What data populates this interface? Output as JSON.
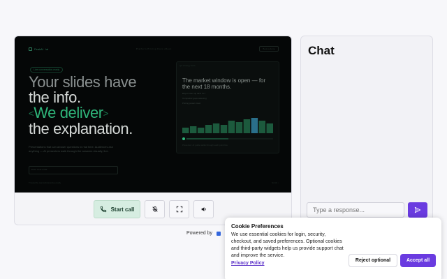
{
  "stage": {
    "brand": "PeakAI",
    "brand_suffix": "/ai",
    "nav": "Platform   Pricing   Docs   About",
    "top_button": "Book a demo",
    "tag": "Live conversation-ready",
    "headline_line1": "Your slides have",
    "headline_line2": "the info.",
    "headline_bracket_open": "<",
    "headline_green": "We deliver",
    "headline_bracket_close": ">",
    "headline_line4": "the explanation.",
    "sub_copy": "Presentations that can answer questions in real time. Audiences ask anything — AI presenters walk through the answers visually, live.",
    "email_label": "Enter work email",
    "footer_left": "Trusted by teams   Enterprise-ready",
    "footer_right": "Scroll ↓",
    "inner_top": "Q3 strategy deck",
    "inner_title": "The market window is open — for the next 18 months.",
    "inner_bullets": [
      "Buyer intent up 32% YoY",
      "Competitor gaps widening",
      "Pricing power intact"
    ],
    "inner_foot": "Presenter: AI guide walks through each point live"
  },
  "controls": {
    "start_call": "Start call"
  },
  "powered_by": "Powered by",
  "chat": {
    "title": "Chat",
    "placeholder": "Type a response..."
  },
  "cookie": {
    "title": "Cookie Preferences",
    "text": "We use essential cookies for login, security, checkout, and saved preferences. Optional cookies and third-party widgets help us provide support chat and improve the service.",
    "policy_link": "Privacy Policy",
    "reject_label": "Reject optional",
    "accept_label": "Accept all"
  },
  "chart_bars": [
    4,
    5,
    4,
    6,
    7,
    6,
    9,
    8,
    10,
    11,
    9,
    7
  ],
  "highlight_bar_index": 9,
  "colors": {
    "accent": "#6a3be0",
    "call_bg": "#d6ede1",
    "stage_green": "#2fb57a"
  }
}
